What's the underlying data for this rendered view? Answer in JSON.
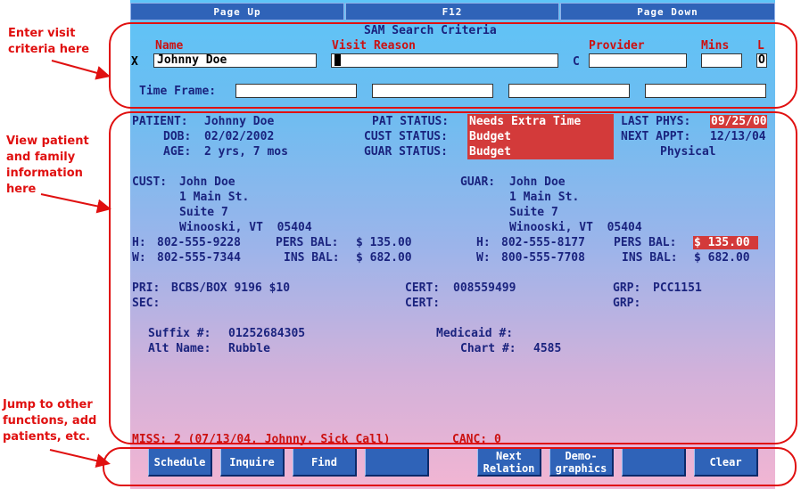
{
  "top_bar": {
    "page_up": "Page Up",
    "f12": "F12",
    "page_down": "Page Down"
  },
  "search": {
    "title": "SAM Search Criteria",
    "labels": {
      "name": "Name",
      "visit_reason": "Visit Reason",
      "provider": "Provider",
      "mins": "Mins",
      "l": "L",
      "time_frame": "Time Frame:"
    },
    "x_prefix": "X",
    "name_value": "Johnny Doe",
    "visit_reason_value": "",
    "c_prefix": "C",
    "provider_value": "",
    "mins_value": "",
    "l_value": "O",
    "time_frame_values": [
      "",
      "",
      "",
      ""
    ]
  },
  "patient": {
    "patient_label": "PATIENT:",
    "patient_name": "Johnny Doe",
    "dob_label": "DOB:",
    "dob": "02/02/2002",
    "age_label": "AGE:",
    "age": "2 yrs, 7 mos",
    "pat_status_label": "PAT STATUS:",
    "pat_status": "Needs Extra Time",
    "cust_status_label": "CUST STATUS:",
    "cust_status": "Budget",
    "guar_status_label": "GUAR STATUS:",
    "guar_status": "Budget",
    "last_phys_label": "LAST PHYS:",
    "last_phys": "09/25/00",
    "next_appt_label": "NEXT APPT:",
    "next_appt": "12/13/04",
    "next_appt_type": "Physical"
  },
  "cust": {
    "label": "CUST:",
    "name": "John Doe",
    "addr1": "1 Main St.",
    "addr2": "Suite 7",
    "city": "Winooski, VT  05404",
    "h_label": "H:",
    "h_phone": "802-555-9228",
    "w_label": "W:",
    "w_phone": "802-555-7344",
    "pers_bal_label": "PERS BAL:",
    "pers_bal": "$ 135.00",
    "ins_bal_label": "INS BAL:",
    "ins_bal": "$ 682.00"
  },
  "guar": {
    "label": "GUAR:",
    "name": "John Doe",
    "addr1": "1 Main St.",
    "addr2": "Suite 7",
    "city": "Winooski, VT  05404",
    "h_label": "H:",
    "h_phone": "802-555-8177",
    "w_label": "W:",
    "w_phone": "800-555-7708",
    "pers_bal_label": "PERS BAL:",
    "pers_bal": "$ 135.00",
    "ins_bal_label": "INS BAL:",
    "ins_bal": "$ 682.00"
  },
  "insurance": {
    "pri_label": "PRI:",
    "pri": "BCBS/BOX 9196 $10",
    "cert_label": "CERT:",
    "cert1": "008559499",
    "grp_label": "GRP:",
    "grp1": "PCC1151",
    "sec_label": "SEC:",
    "sec": "",
    "cert2": "",
    "grp2": ""
  },
  "ids": {
    "suffix_label": "Suffix #:",
    "suffix": "01252684305",
    "medicaid_label": "Medicaid #:",
    "medicaid": "",
    "alt_label": "Alt Name:",
    "alt_name": "Rubble",
    "chart_label": "Chart #:",
    "chart": "4585"
  },
  "misc": {
    "miss": "MISS: 2 (07/13/04, Johnny, Sick Call)",
    "canc": "CANC: 0"
  },
  "function_keys": {
    "schedule": "Schedule",
    "inquire": "Inquire",
    "find": "Find",
    "blank1": "",
    "next_relation_1": "Next",
    "next_relation_2": "Relation",
    "demographics_1": "Demo-",
    "demographics_2": "graphics",
    "blank2": "",
    "clear": "Clear"
  },
  "annotations": {
    "enter_visit_1": "Enter visit",
    "enter_visit_2": "criteria here",
    "view_1": "View patient",
    "view_2": "and family",
    "view_3": "information",
    "view_4": "here",
    "jump_1": "Jump to other",
    "jump_2": "functions, add",
    "jump_3": "patients, etc."
  },
  "colors": {
    "annotation": "#e01010",
    "highlight": "#d33a3a",
    "button": "#2f63b8",
    "text": "#1a237e"
  }
}
